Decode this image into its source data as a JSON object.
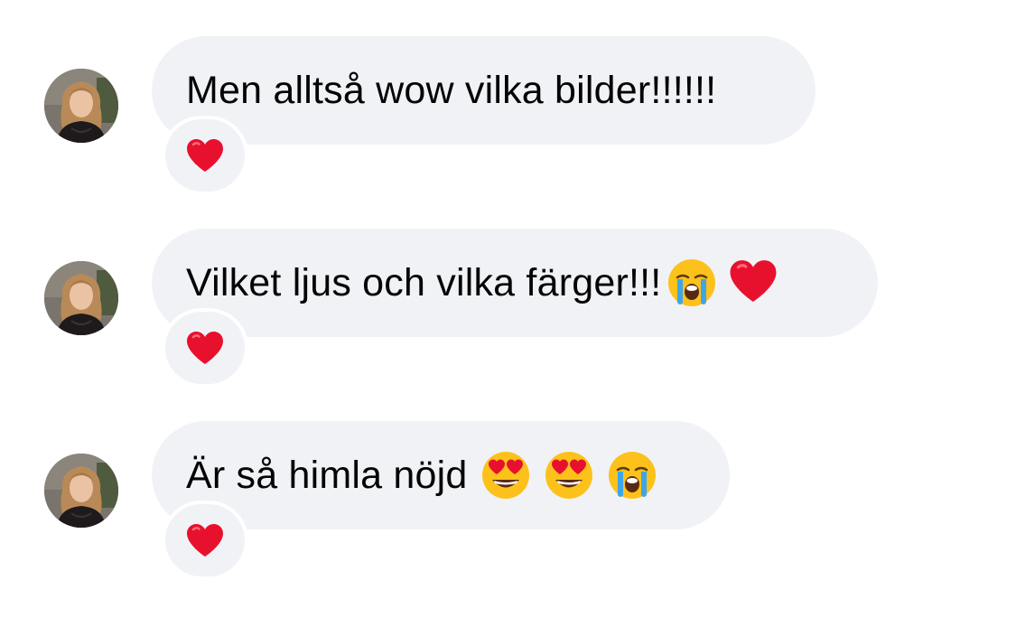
{
  "messages": [
    {
      "text": "Men alltså wow vilka bilder!!!!!!",
      "emojis": [],
      "reaction": "red-heart-icon"
    },
    {
      "text": "Vilket ljus och vilka färger!!!",
      "emojis": [
        "loudly-crying-face-icon",
        "red-heart-icon"
      ],
      "reaction": "red-heart-icon"
    },
    {
      "text": "Är så himla nöjd ",
      "emojis": [
        "heart-eyes-face-icon",
        "heart-eyes-face-icon",
        "loudly-crying-face-icon"
      ],
      "reaction": "red-heart-icon"
    }
  ],
  "colors": {
    "bubble_background": "#f1f2f6",
    "text": "#050505",
    "heart": "#e8112d",
    "emoji_face": "#fcc21b"
  }
}
